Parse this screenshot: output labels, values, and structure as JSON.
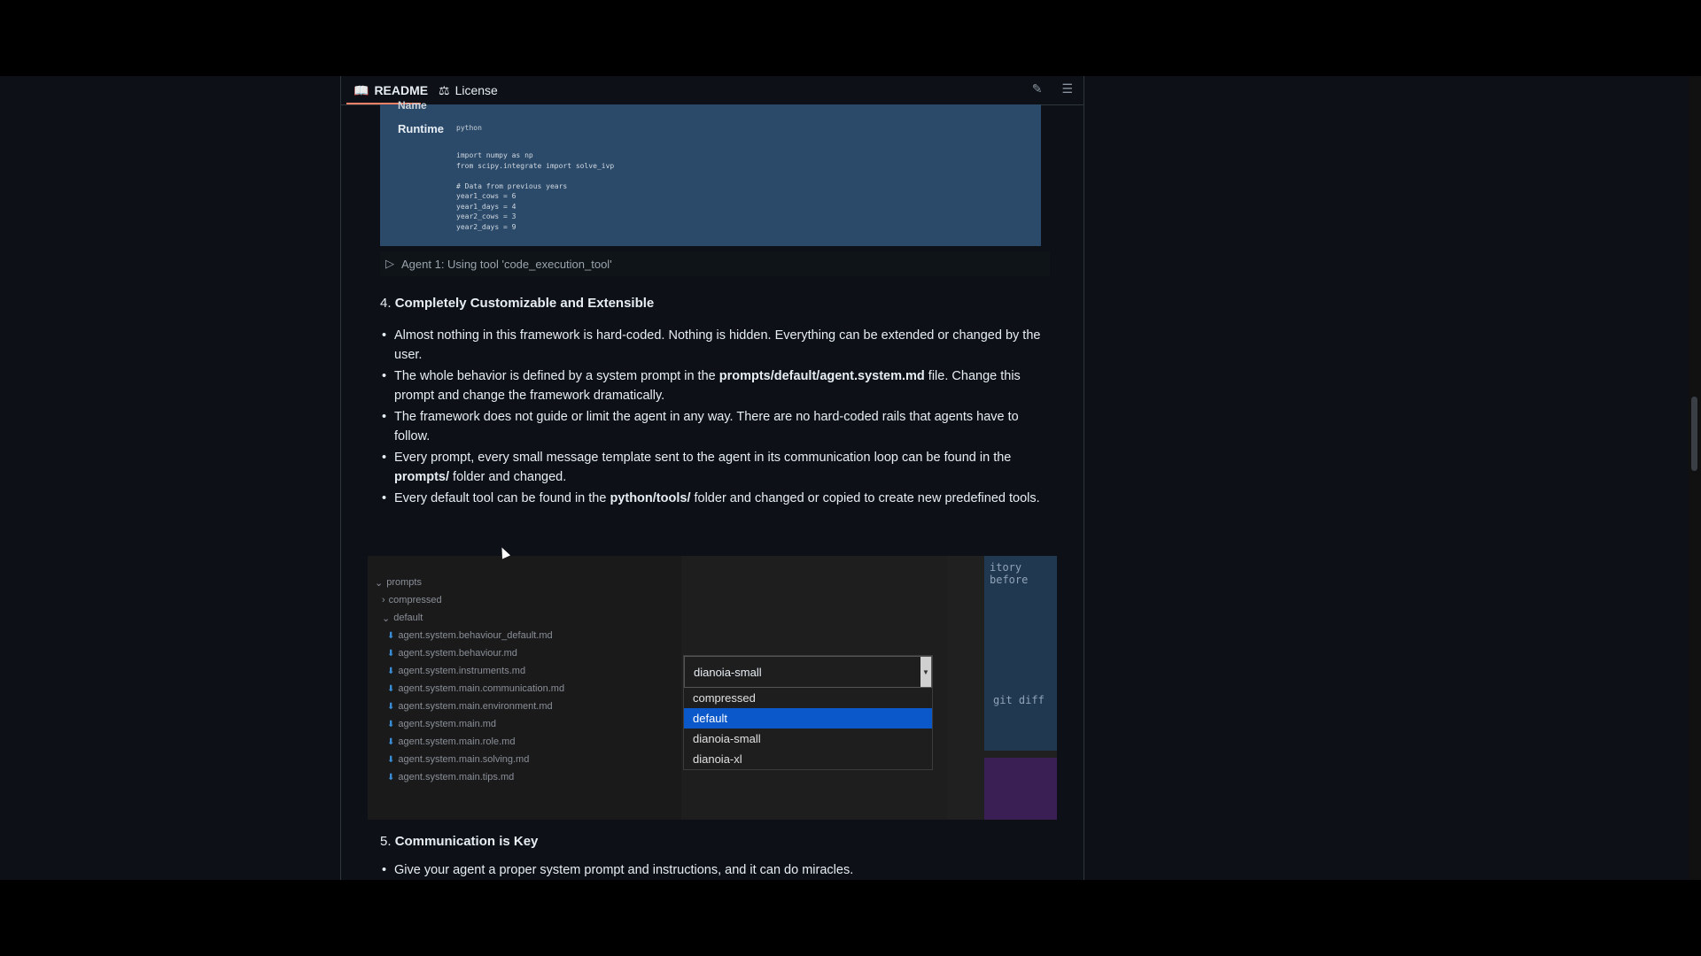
{
  "tabs": {
    "readme": "README",
    "license": "License"
  },
  "codecard": {
    "name_cut": "Name",
    "runtime_label": "Runtime",
    "runtime_value": "python",
    "code": "import numpy as np\nfrom scipy.integrate import solve_ivp\n\n# Data from previous years\nyear1_cows = 6\nyear1_days = 4\nyear2_cows = 3\nyear2_days = 9"
  },
  "agent_bar": "Agent 1: Using tool 'code_execution_tool'",
  "section4": {
    "number": "4.",
    "title": "Completely Customizable and Extensible"
  },
  "bullets": [
    {
      "parts": [
        "Almost nothing in this framework is hard-coded. Nothing is hidden. Everything can be extended or changed by the user."
      ]
    },
    {
      "parts": [
        "The whole behavior is defined by a system prompt in the ",
        "prompts/default/agent.system.md",
        " file. Change this prompt and change the framework dramatically."
      ]
    },
    {
      "parts": [
        "The framework does not guide or limit the agent in any way. There are no hard-coded rails that agents have to follow."
      ]
    },
    {
      "parts": [
        "Every prompt, every small message template sent to the agent in its communication loop can be found in the ",
        "prompts/",
        " folder and changed."
      ]
    },
    {
      "parts": [
        "Every default tool can be found in the ",
        "python/tools/",
        " folder and changed or copied to create new predefined tools."
      ]
    }
  ],
  "tree": {
    "root": "prompts",
    "folders": [
      "compressed",
      "default"
    ],
    "files": [
      "agent.system.behaviour_default.md",
      "agent.system.behaviour.md",
      "agent.system.instruments.md",
      "agent.system.main.communication.md",
      "agent.system.main.environment.md",
      "agent.system.main.md",
      "agent.system.main.role.md",
      "agent.system.main.solving.md",
      "agent.system.main.tips.md"
    ]
  },
  "dropdown": {
    "selected": "dianoia-small",
    "options": [
      "compressed",
      "default",
      "dianoia-small",
      "dianoia-xl"
    ],
    "highlighted": "default"
  },
  "code_fragment": {
    "line1": "itory before",
    "line2": "git diff"
  },
  "section5": {
    "number": "5.",
    "title": "Communication is Key"
  },
  "section5_bullet": "Give your agent a proper system prompt and instructions, and it can do miracles."
}
